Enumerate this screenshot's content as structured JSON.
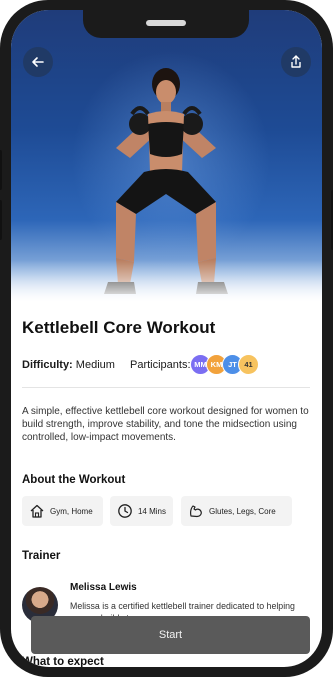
{
  "workout": {
    "title": "Kettlebell Core Workout",
    "difficulty_label": "Difficulty:",
    "difficulty_value": "Medium",
    "participants_label": "Participants:",
    "participants": [
      {
        "initials": "MM",
        "color": "#7b6ef2"
      },
      {
        "initials": "KM",
        "color": "#f2a23c"
      },
      {
        "initials": "JT",
        "color": "#4d8fe8"
      }
    ],
    "participants_count": "41",
    "participants_count_color": "#f7c35f",
    "description": "A simple, effective kettlebell core workout designed for women to build strength, improve stability, and tone the midsection using controlled, low-impact movements."
  },
  "about": {
    "title": "About the Workout",
    "chips": [
      {
        "icon": "house-icon",
        "text": "Gym,   Home"
      },
      {
        "icon": "clock-icon",
        "text": "14 Mins"
      },
      {
        "icon": "flexed-arm-icon",
        "text": "Glutes,   Legs,   Core"
      }
    ]
  },
  "trainer": {
    "section_title": "Trainer",
    "name": "Melissa Lewis",
    "bio": "Melissa is a certified kettlebell trainer dedicated to helping women build stren..."
  },
  "next_section_title": "What to expect",
  "actions": {
    "start_label": "Start"
  },
  "colors": {
    "accent_button": "#5a5a5a",
    "circle_button": "#203a66"
  }
}
